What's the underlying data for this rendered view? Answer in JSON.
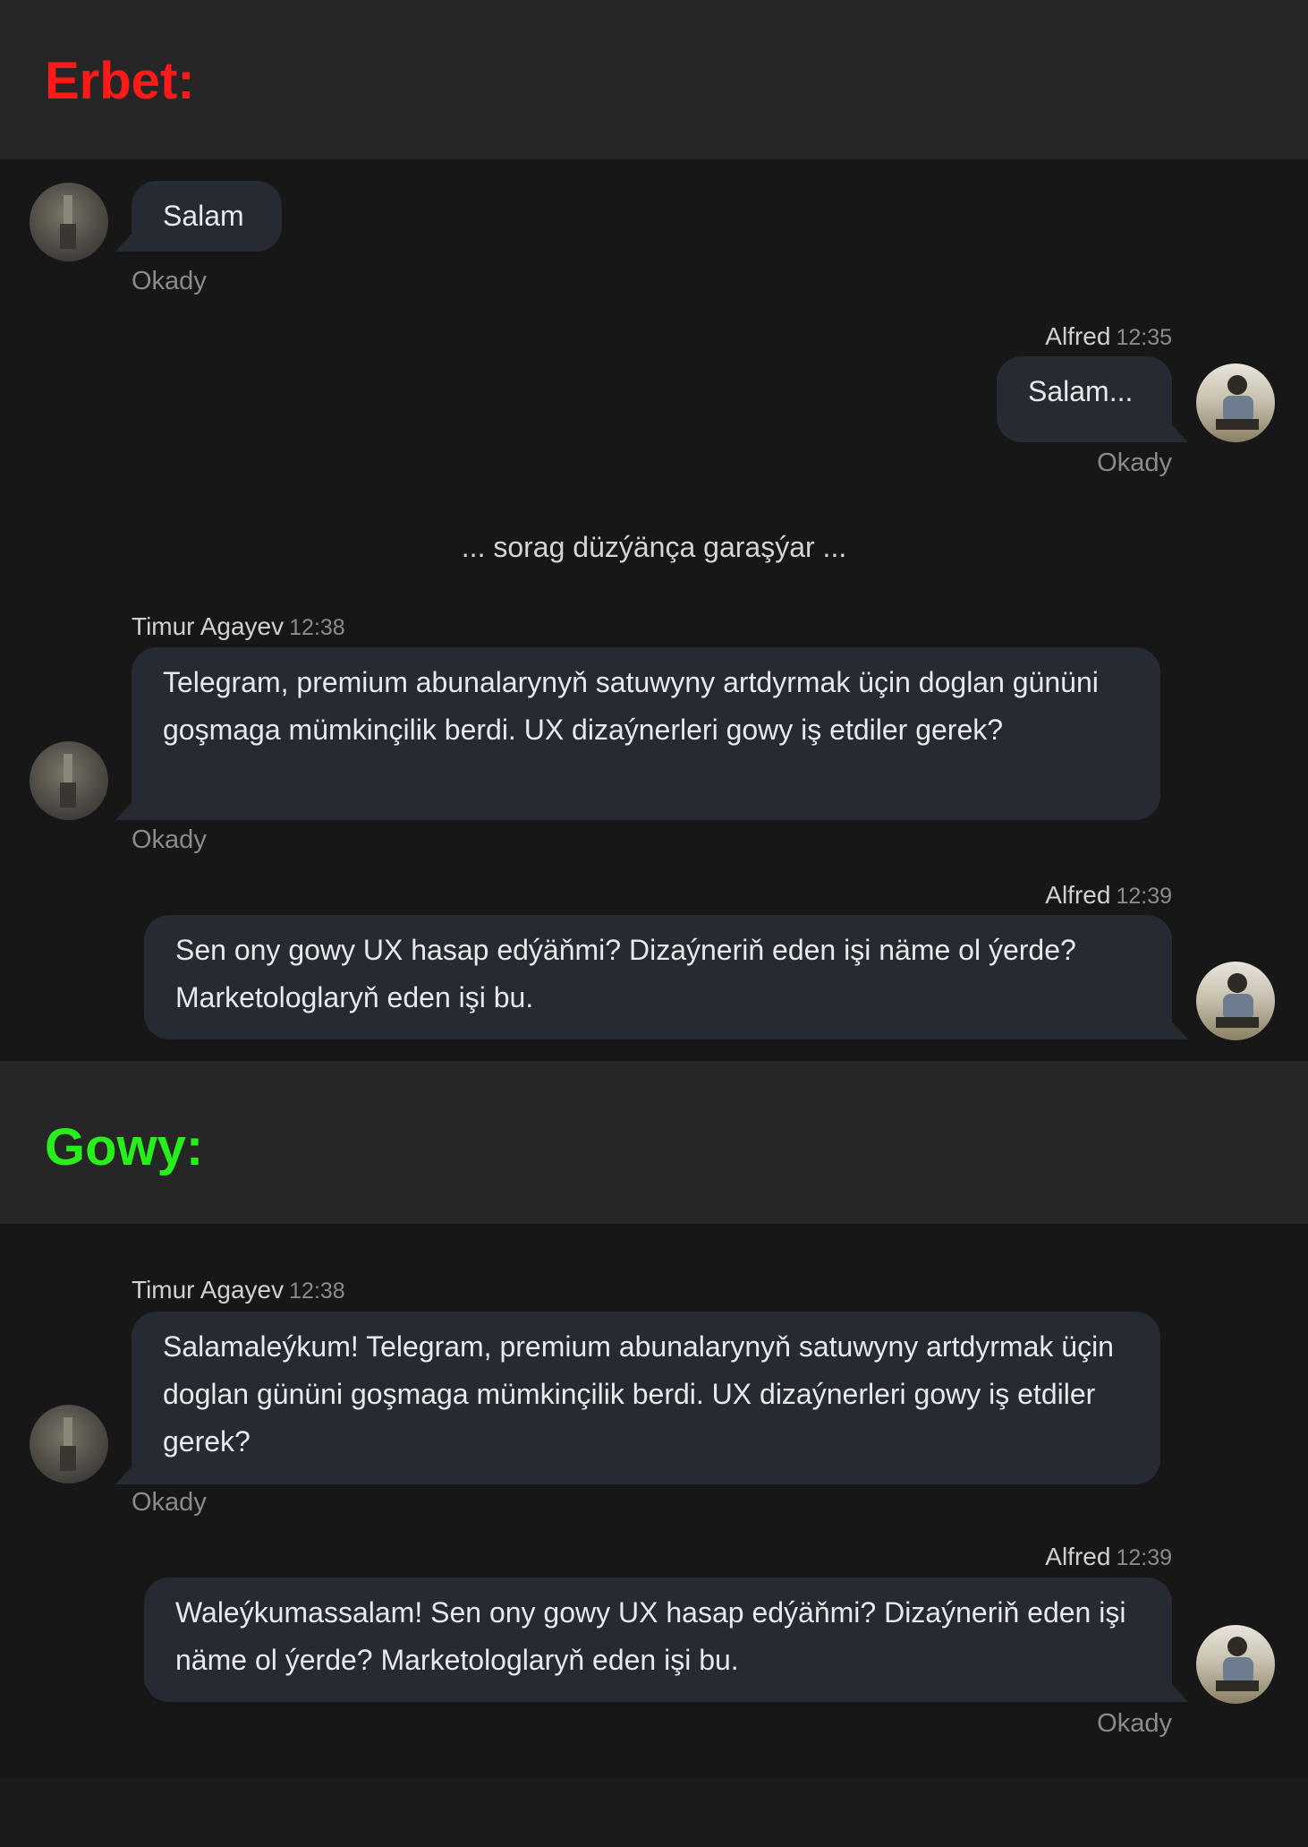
{
  "colors": {
    "bad_label": "#ff1a1a",
    "good_label": "#27ee1c",
    "bubble_bg": "#262a33",
    "panel_bg": "#171718",
    "header_bg": "#262627"
  },
  "sections": [
    {
      "label": "Erbet:",
      "messages": [
        {
          "sender": "",
          "time": "",
          "text": "Salam",
          "status": "Okady"
        },
        {
          "sender": "Alfred",
          "time": "12:35",
          "text": "Salam...",
          "status": "Okady"
        },
        {
          "system": "... sorag düzýänça garaşýar ..."
        },
        {
          "sender": "Timur Agayev",
          "time": "12:38",
          "text": "Telegram, premium abunalarynyň satuwyny artdyrmak üçin doglan gününi goşmaga mümkinçilik berdi. UX dizaýnerleri gowy iş etdiler gerek?",
          "status": "Okady"
        },
        {
          "sender": "Alfred",
          "time": "12:39",
          "text": "Sen ony gowy UX hasap edýäňmi? Dizaýneriň eden işi näme ol ýerde? Marketologlaryň eden işi bu."
        }
      ]
    },
    {
      "label": "Gowy:",
      "messages": [
        {
          "sender": "Timur Agayev",
          "time": "12:38",
          "text": "Salamaleýkum! Telegram, premium abunalarynyň satuwyny artdyrmak üçin doglan gününi goşmaga mümkinçilik berdi. UX dizaýnerleri gowy iş etdiler gerek?",
          "status": "Okady"
        },
        {
          "sender": "Alfred",
          "time": "12:39",
          "text": "Waleýkumassalam! Sen ony gowy UX hasap edýäňmi? Dizaýneriň eden işi näme ol ýerde? Marketologlaryň eden işi bu.",
          "status": "Okady"
        }
      ]
    }
  ]
}
